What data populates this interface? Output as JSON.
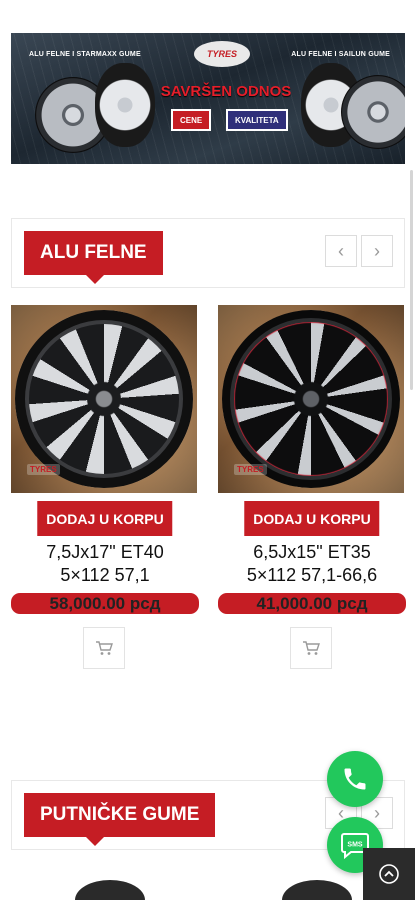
{
  "banner": {
    "left_tag": "ALU FELNE I STARMAXX GUME",
    "right_tag": "ALU FELNE I SAILUN GUME",
    "logo": "TYRES",
    "headline": "SAVRŠEN ODNOS",
    "pill_1": "CENE",
    "pill_2": "KVALITETA"
  },
  "sections": {
    "alu": {
      "title": "ALU FELNE",
      "prev": "‹",
      "next": "›"
    },
    "putnicke": {
      "title": "PUTNIČKE GUME",
      "prev": "‹",
      "next": "›"
    }
  },
  "products": [
    {
      "button": "DODAJ U KORPU",
      "name_line1": "7,5Jx17\" ET40",
      "name_line2": "5×112 57,1",
      "price": "58,000.00 рсд",
      "stamp": "TYRES"
    },
    {
      "button": "DODAJ U KORPU",
      "name_line1": "6,5Jx15\" ET35",
      "name_line2": "5×112 57,1-66,6",
      "price": "41,000.00 рсд",
      "stamp": "TYRES"
    }
  ],
  "icons": {
    "cart": "cart-icon",
    "phone": "phone-icon",
    "sms": "sms-icon",
    "top": "arrow-up-icon"
  },
  "fab": {
    "sms_label": "SMS"
  },
  "colors": {
    "accent": "#c51d24",
    "fab": "#22c85c",
    "dark": "#2b2b2b"
  }
}
